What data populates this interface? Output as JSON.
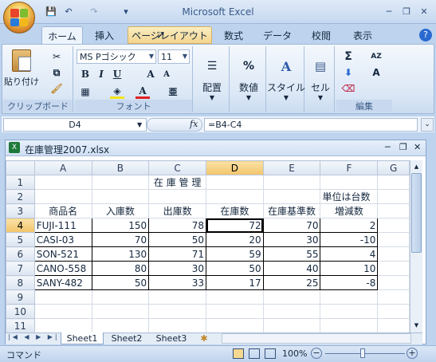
{
  "window": {
    "title": "Microsoft Excel",
    "minimize": "─",
    "maximize": "❐",
    "close": "✕"
  },
  "quick_access": {
    "save": "💾",
    "undo": "↶",
    "redo": "↷",
    "customize": "▾"
  },
  "tabs": [
    {
      "label": "ホーム",
      "active": true
    },
    {
      "label": "挿入"
    },
    {
      "label": "ページレイアウト",
      "hover": true
    },
    {
      "label": "数式"
    },
    {
      "label": "データ"
    },
    {
      "label": "校閲"
    },
    {
      "label": "表示"
    }
  ],
  "ribbon": {
    "clipboard": {
      "paste": "貼り付け",
      "group": "クリップボード"
    },
    "font": {
      "name": "MS Pゴシック",
      "size": "11",
      "bold": "B",
      "italic": "I",
      "underline": "U",
      "grow": "A",
      "shrink": "A",
      "color": "A",
      "phonetic": "亜",
      "group": "フォント"
    },
    "alignment": {
      "label": "配置"
    },
    "number": {
      "label": "数値",
      "icon": "%"
    },
    "styles": {
      "label": "スタイル"
    },
    "cells": {
      "label": "セル"
    },
    "editing": {
      "sum": "Σ",
      "sort": "AZ",
      "find": "A",
      "group": "編集"
    }
  },
  "formula_bar": {
    "name_box": "D4",
    "fx": "fx",
    "formula": "=B4-C4"
  },
  "workbook": {
    "title": "在庫管理2007.xlsx",
    "columns": [
      "A",
      "B",
      "C",
      "D",
      "E",
      "F",
      "G"
    ],
    "selected_col": "D",
    "selected_row": "4",
    "rows": [
      {
        "num": "1",
        "cells": [
          "",
          "",
          "在 庫 管 理",
          "",
          "",
          "",
          ""
        ]
      },
      {
        "num": "2",
        "cells": [
          "",
          "",
          "",
          "",
          "",
          "単位は台数",
          ""
        ]
      },
      {
        "num": "3",
        "cells": [
          "商品名",
          "入庫数",
          "出庫数",
          "在庫数",
          "在庫基準数",
          "増減数",
          ""
        ]
      },
      {
        "num": "4",
        "cells": [
          "FUJI-111",
          "150",
          "78",
          "72",
          "70",
          "2",
          ""
        ]
      },
      {
        "num": "5",
        "cells": [
          "CASI-03",
          "70",
          "50",
          "20",
          "30",
          "-10",
          ""
        ]
      },
      {
        "num": "6",
        "cells": [
          "SON-521",
          "130",
          "71",
          "59",
          "55",
          "4",
          ""
        ]
      },
      {
        "num": "7",
        "cells": [
          "CANO-558",
          "80",
          "30",
          "50",
          "40",
          "10",
          ""
        ]
      },
      {
        "num": "8",
        "cells": [
          "SANY-482",
          "50",
          "33",
          "17",
          "25",
          "-8",
          ""
        ]
      },
      {
        "num": "9",
        "cells": [
          "",
          "",
          "",
          "",
          "",
          "",
          ""
        ]
      },
      {
        "num": "10",
        "cells": [
          "",
          "",
          "",
          "",
          "",
          "",
          ""
        ]
      },
      {
        "num": "11",
        "cells": [
          "",
          "",
          "",
          "",
          "",
          "",
          ""
        ]
      }
    ],
    "sheets": [
      "Sheet1",
      "Sheet2",
      "Sheet3"
    ],
    "active_sheet": "Sheet1"
  },
  "status": {
    "mode": "コマンド",
    "zoom": "100%",
    "zoom_out": "−",
    "zoom_in": "+"
  },
  "colors": {
    "accent": "#bdd3ee",
    "selected_header": "#f2c46a"
  }
}
